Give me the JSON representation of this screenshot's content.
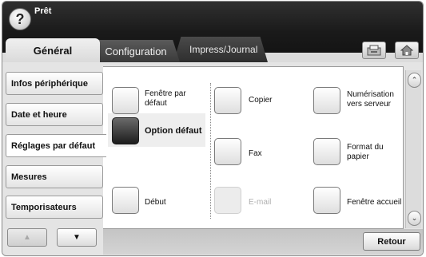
{
  "header": {
    "help_glyph": "?",
    "status": "Prêt"
  },
  "tabs": [
    {
      "label": "Général",
      "active": true
    },
    {
      "label": "Configuration",
      "active": false
    },
    {
      "label": "Impress/Journal",
      "active": false
    }
  ],
  "header_buttons": [
    {
      "icon": "job-status-icon"
    },
    {
      "icon": "home-icon"
    }
  ],
  "sidebar": {
    "items": [
      {
        "label": "Infos périphérique",
        "active": false
      },
      {
        "label": "Date et heure",
        "active": false
      },
      {
        "label": "Réglages par défaut",
        "active": true
      },
      {
        "label": "Mesures",
        "active": false
      },
      {
        "label": "Temporisateurs",
        "active": false
      }
    ],
    "nav_up": "▲",
    "nav_down": "▼"
  },
  "options": {
    "col1": [
      {
        "label": "Fenêtre par défaut",
        "selected": false,
        "disabled": false
      },
      {
        "label": "Option défaut",
        "selected": true,
        "disabled": false
      },
      {
        "label": "Début",
        "selected": false,
        "disabled": false
      }
    ],
    "col2": [
      {
        "label": "Copier",
        "selected": false,
        "disabled": false
      },
      {
        "label": "Fax",
        "selected": false,
        "disabled": false
      },
      {
        "label": "E-mail",
        "selected": false,
        "disabled": true
      }
    ],
    "col3": [
      {
        "label": "Numérisation vers serveur",
        "selected": false,
        "disabled": false
      },
      {
        "label": "Format du papier",
        "selected": false,
        "disabled": false
      },
      {
        "label": "Fenêtre accueil",
        "selected": false,
        "disabled": false
      }
    ]
  },
  "scroll": {
    "up": "⌃",
    "down": "⌄"
  },
  "footer": {
    "back_label": "Retour"
  }
}
